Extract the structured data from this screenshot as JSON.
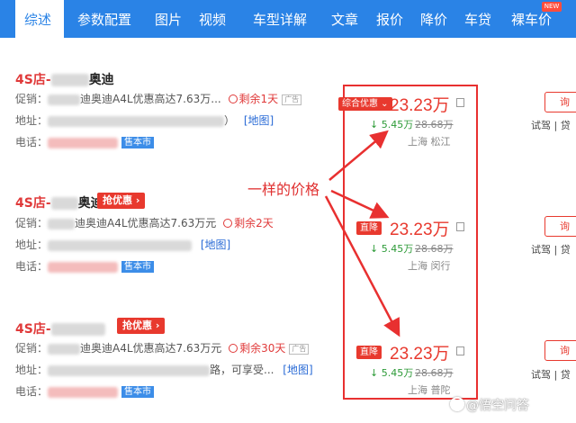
{
  "nav": {
    "tabs": [
      {
        "label": "综述"
      },
      {
        "label": "参数配置"
      },
      {
        "label": "图片"
      },
      {
        "label": "视频"
      },
      {
        "label": "车型详解"
      },
      {
        "label": "文章"
      },
      {
        "label": "报价"
      },
      {
        "label": "降价"
      },
      {
        "label": "车贷"
      },
      {
        "label": "裸车价"
      }
    ],
    "new_badge": "NEW"
  },
  "dealers": [
    {
      "prefix": "4S店-",
      "brand": "奥迪",
      "promo_label": "促销：",
      "promo_text": "迪奥迪A4L优惠高达7.63万...",
      "remaining": "剩余1天",
      "ad": "广告",
      "addr_label": "地址：",
      "addr_tail": "）",
      "map": "[地图]",
      "tel_label": "电话：",
      "sold": "售本市",
      "tag": "综合优惠",
      "price": "23.23万",
      "drop": "5.45万",
      "orig": "28.68万",
      "loc": "上海 松江"
    },
    {
      "prefix": "4S店-",
      "brand": "奥迪",
      "deal": "抢优惠",
      "promo_label": "促销：",
      "promo_text": "迪奥迪A4L优惠高达7.63万元",
      "remaining": "剩余2天",
      "addr_label": "地址：",
      "map": "[地图]",
      "tel_label": "电话：",
      "sold": "售本市",
      "tag": "直降",
      "price": "23.23万",
      "drop": "5.45万",
      "orig": "28.68万",
      "loc": "上海 闵行"
    },
    {
      "prefix": "4S店-",
      "deal": "抢优惠",
      "promo_label": "促销：",
      "promo_text": "迪奥迪A4L优惠高达7.63万元",
      "remaining": "剩余30天",
      "ad": "广告",
      "addr_label": "地址：",
      "addr_tail": "路，可享受...",
      "map": "[地图]",
      "tel_label": "电话：",
      "sold": "售本市",
      "tag": "直降",
      "price": "23.23万",
      "drop": "5.45万",
      "orig": "28.68万",
      "loc": "上海 普陀"
    }
  ],
  "annotation": "一样的价格",
  "side": {
    "inquire": "询",
    "test_drive": "试驾",
    "loan": "贷"
  },
  "watermark": "@悟空问答",
  "colors": {
    "nav_blue": "#2a83e6",
    "price_red": "#e8392e",
    "drop_green": "#2c9a37",
    "highlight_red": "#e83030"
  }
}
